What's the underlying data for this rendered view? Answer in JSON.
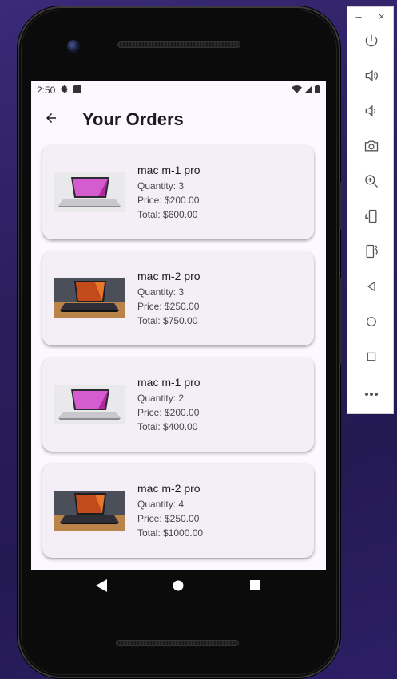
{
  "status_bar": {
    "time": "2:50"
  },
  "app_bar": {
    "title": "Your Orders"
  },
  "orders": [
    {
      "name": "mac m-1 pro",
      "quantity": "Quantity: 3",
      "price": "Price: $200.00",
      "total": "Total: $600.00",
      "image": "mac-m1-pink"
    },
    {
      "name": "mac m-2 pro",
      "quantity": "Quantity: 3",
      "price": "Price: $250.00",
      "total": "Total: $750.00",
      "image": "mac-m2-orange"
    },
    {
      "name": "mac m-1 pro",
      "quantity": "Quantity: 2",
      "price": "Price: $200.00",
      "total": "Total: $400.00",
      "image": "mac-m1-pink"
    },
    {
      "name": "mac m-2 pro",
      "quantity": "Quantity: 4",
      "price": "Price: $250.00",
      "total": "Total: $1000.00",
      "image": "mac-m2-orange"
    }
  ],
  "emulator_panel": {
    "minimize": "–",
    "close": "×",
    "buttons": [
      "power-icon",
      "volume-up-icon",
      "volume-down-icon",
      "camera-icon",
      "zoom-icon",
      "rotate-left-icon",
      "rotate-right-icon",
      "back-icon",
      "home-icon",
      "overview-icon",
      "more-icon"
    ]
  },
  "colors": {
    "screen_bg": "#fdf7ff",
    "card_bg": "#f4eff6",
    "title": "#1c1b1f",
    "desktop_bg": "#2a1d5c"
  }
}
